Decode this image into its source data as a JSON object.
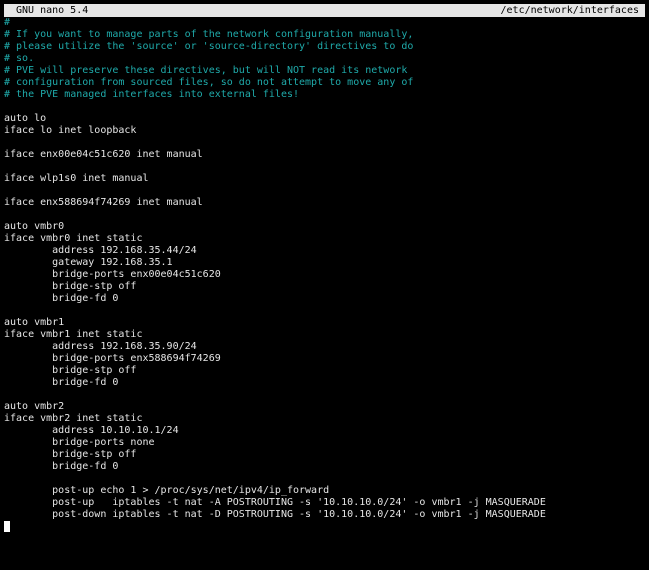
{
  "colors": {
    "background": "#000000",
    "text": "#e6e6e6",
    "comment": "#1faaaa",
    "titlebar_bg": "#e6e6e6",
    "titlebar_fg": "#000000"
  },
  "titlebar": {
    "app": "GNU nano 5.4",
    "file": "/etc/network/interfaces"
  },
  "lines": [
    {
      "text": "#",
      "comment": true
    },
    {
      "text": "# If you want to manage parts of the network configuration manually,",
      "comment": true
    },
    {
      "text": "# please utilize the 'source' or 'source-directory' directives to do",
      "comment": true
    },
    {
      "text": "# so.",
      "comment": true
    },
    {
      "text": "# PVE will preserve these directives, but will NOT read its network",
      "comment": true
    },
    {
      "text": "# configuration from sourced files, so do not attempt to move any of",
      "comment": true
    },
    {
      "text": "# the PVE managed interfaces into external files!",
      "comment": true
    },
    {
      "text": "",
      "comment": false
    },
    {
      "text": "auto lo",
      "comment": false
    },
    {
      "text": "iface lo inet loopback",
      "comment": false
    },
    {
      "text": "",
      "comment": false
    },
    {
      "text": "iface enx00e04c51c620 inet manual",
      "comment": false
    },
    {
      "text": "",
      "comment": false
    },
    {
      "text": "iface wlp1s0 inet manual",
      "comment": false
    },
    {
      "text": "",
      "comment": false
    },
    {
      "text": "iface enx588694f74269 inet manual",
      "comment": false
    },
    {
      "text": "",
      "comment": false
    },
    {
      "text": "auto vmbr0",
      "comment": false
    },
    {
      "text": "iface vmbr0 inet static",
      "comment": false
    },
    {
      "text": "        address 192.168.35.44/24",
      "comment": false
    },
    {
      "text": "        gateway 192.168.35.1",
      "comment": false
    },
    {
      "text": "        bridge-ports enx00e04c51c620",
      "comment": false
    },
    {
      "text": "        bridge-stp off",
      "comment": false
    },
    {
      "text": "        bridge-fd 0",
      "comment": false
    },
    {
      "text": "",
      "comment": false
    },
    {
      "text": "auto vmbr1",
      "comment": false
    },
    {
      "text": "iface vmbr1 inet static",
      "comment": false
    },
    {
      "text": "        address 192.168.35.90/24",
      "comment": false
    },
    {
      "text": "        bridge-ports enx588694f74269",
      "comment": false
    },
    {
      "text": "        bridge-stp off",
      "comment": false
    },
    {
      "text": "        bridge-fd 0",
      "comment": false
    },
    {
      "text": "",
      "comment": false
    },
    {
      "text": "auto vmbr2",
      "comment": false
    },
    {
      "text": "iface vmbr2 inet static",
      "comment": false
    },
    {
      "text": "        address 10.10.10.1/24",
      "comment": false
    },
    {
      "text": "        bridge-ports none",
      "comment": false
    },
    {
      "text": "        bridge-stp off",
      "comment": false
    },
    {
      "text": "        bridge-fd 0",
      "comment": false
    },
    {
      "text": "",
      "comment": false
    },
    {
      "text": "        post-up echo 1 > /proc/sys/net/ipv4/ip_forward",
      "comment": false
    },
    {
      "text": "        post-up   iptables -t nat -A POSTROUTING -s '10.10.10.0/24' -o vmbr1 -j MASQUERADE",
      "comment": false
    },
    {
      "text": "        post-down iptables -t nat -D POSTROUTING -s '10.10.10.0/24' -o vmbr1 -j MASQUERADE",
      "comment": false
    },
    {
      "text": "",
      "comment": false
    }
  ]
}
